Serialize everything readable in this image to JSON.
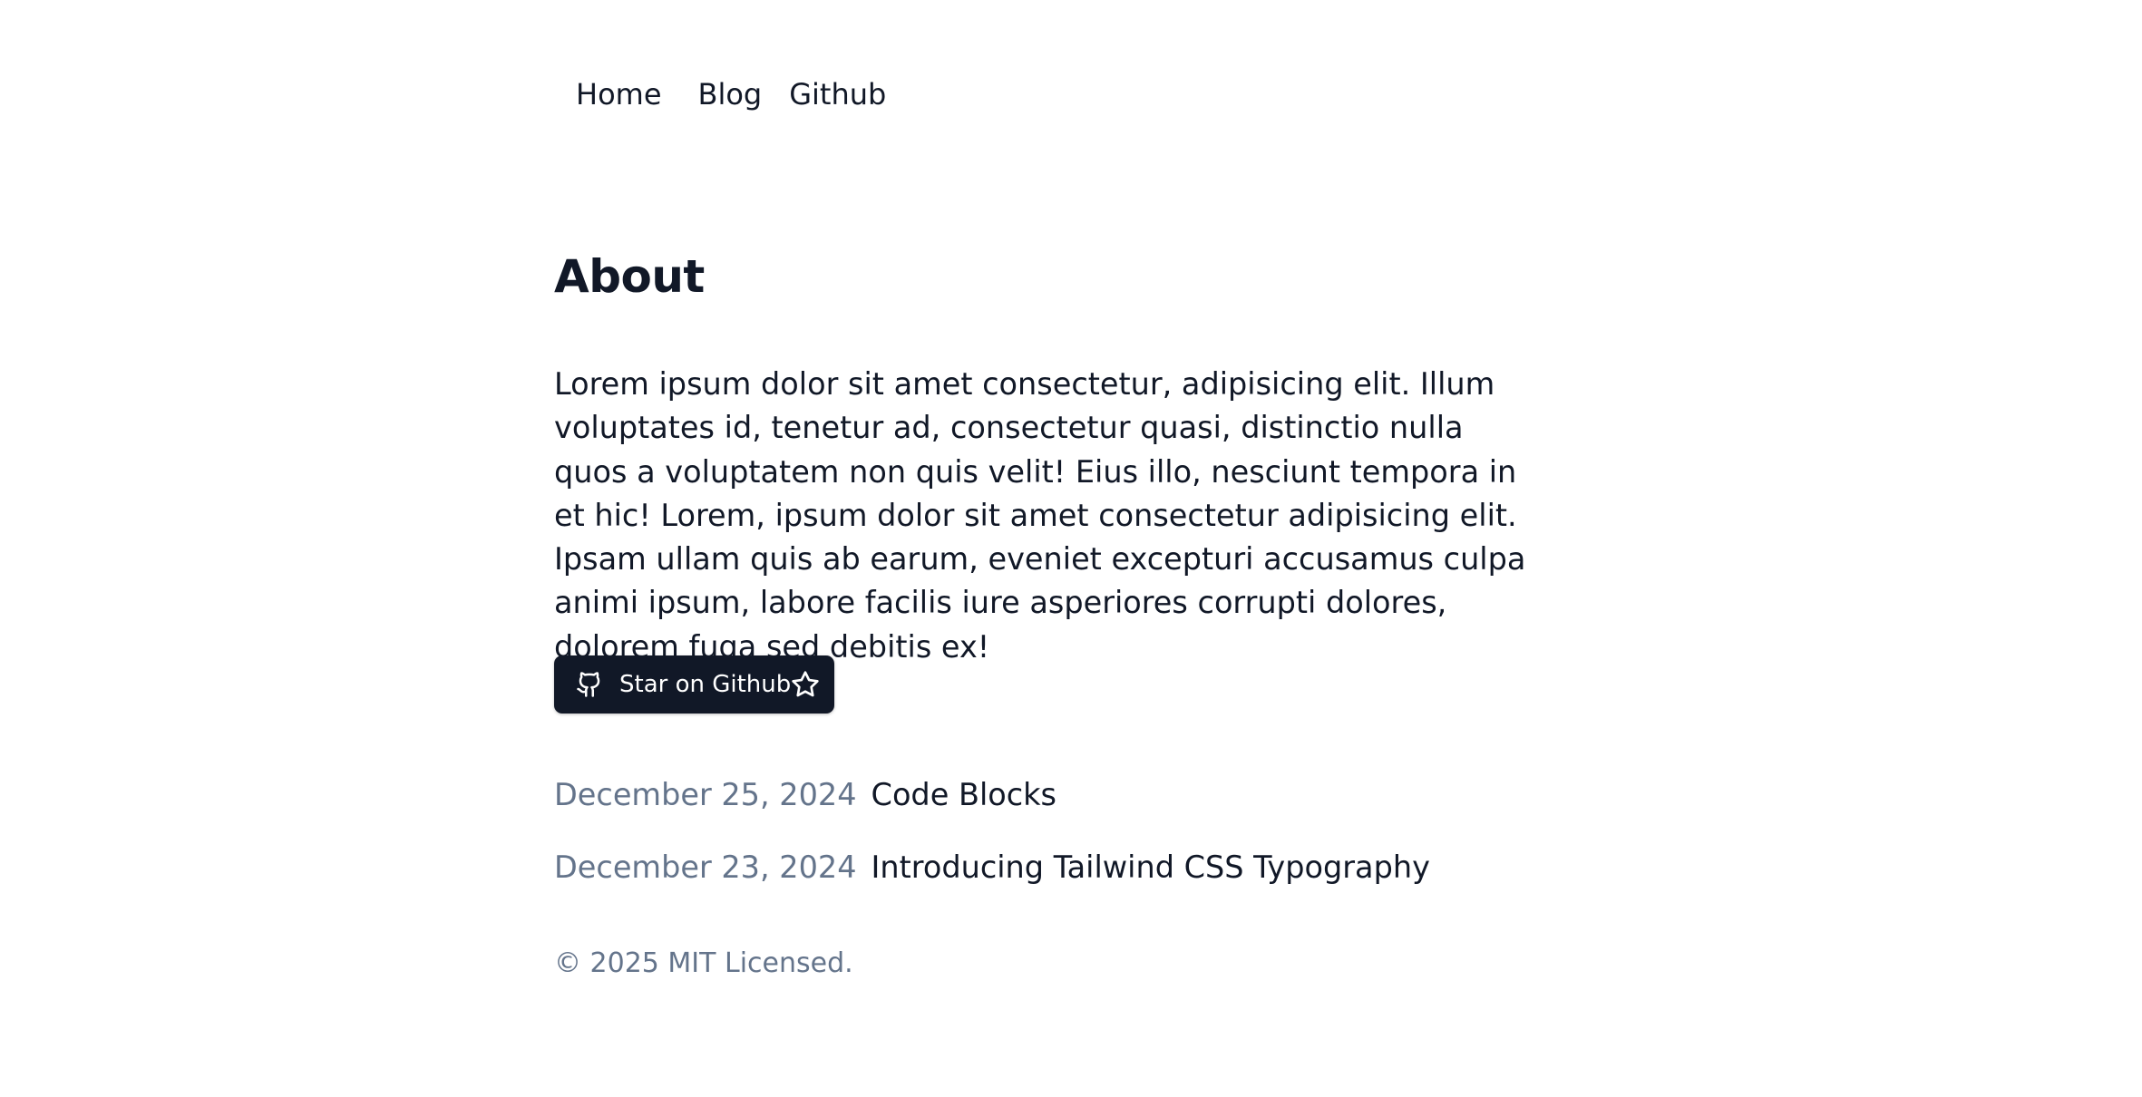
{
  "nav": {
    "home": "Home",
    "blog": "Blog",
    "github": "Github"
  },
  "about": {
    "title": "About",
    "paragraph": "Lorem ipsum dolor sit amet consectetur, adipisicing elit. Illum voluptates id, tenetur ad, consectetur quasi, distinctio nulla quos a voluptatem non quis velit! Eius illo, nesciunt tempora in et hic! Lorem, ipsum dolor sit amet consectetur adipisicing elit. Ipsam ullam quis ab earum, eveniet excepturi accusamus culpa animi ipsum, labore facilis iure asperiores corrupti dolores, dolorem fuga sed debitis ex!"
  },
  "star_button": {
    "label": "Star on Github",
    "left_icon": "github-icon",
    "right_icon": "star-icon",
    "background": "#111827",
    "text_color": "#ffffff"
  },
  "posts": [
    {
      "date": "December 25, 2024",
      "title": "Code Blocks"
    },
    {
      "date": "December 23, 2024",
      "title": "Introducing Tailwind CSS Typography"
    }
  ],
  "footer": {
    "text": "© 2025 MIT Licensed."
  },
  "colors": {
    "text": "#111827",
    "muted": "#64748b",
    "background": "#ffffff"
  }
}
